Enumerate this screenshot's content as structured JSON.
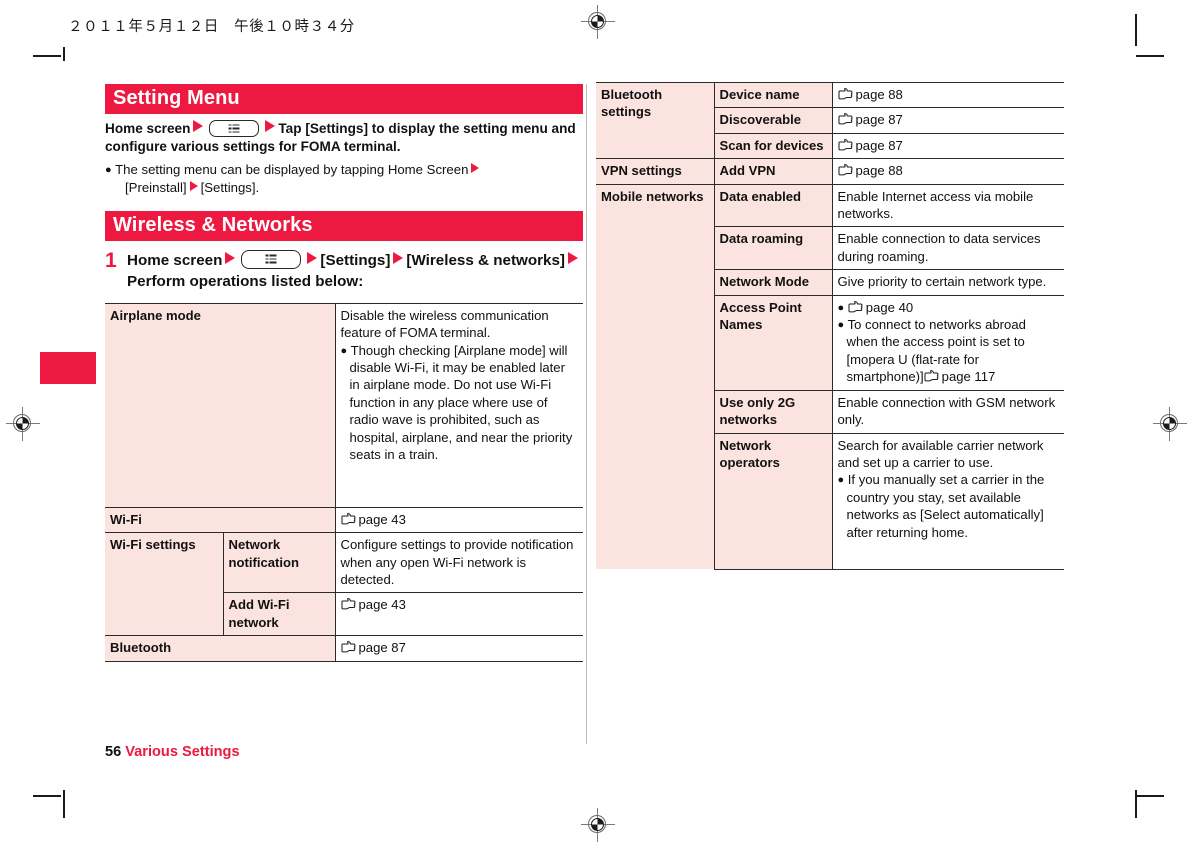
{
  "document": {
    "print_date_header": "２０１１年５月１２日　午後１０時３４分",
    "footer_page_number": "56",
    "footer_section": "Various Settings"
  },
  "colors": {
    "accent_red": "#ED1941",
    "table_header_fill": "#FBE4DF",
    "rule": "#2b2b2b"
  },
  "sections": {
    "setting_menu": {
      "banner": "Setting Menu",
      "lead_prefix": "Home screen",
      "lead_middle": "Tap [Settings] to display the setting menu and configure various settings for FOMA terminal.",
      "note_a": "The setting menu can be displayed by tapping Home Screen",
      "note_b": "[Preinstall]",
      "note_c": "[Settings]."
    },
    "wireless_networks": {
      "banner": "Wireless & Networks",
      "step_number": "1",
      "step_a": "Home screen",
      "step_b": "[Settings]",
      "step_c": "[Wireless & networks]",
      "step_d": "Perform operations listed below:"
    }
  },
  "icons": {
    "menu_key": "menu-key-icon",
    "arrow": "red-right-triangle-icon",
    "page_ref": "pointing-hand-icon"
  },
  "left_table": {
    "rows": [
      {
        "group": "Airplane mode",
        "group_rowspan": 1,
        "sub": null,
        "desc_lines": [
          "Disable the wireless communication feature of FOMA terminal."
        ],
        "desc_bullets": [
          "Though checking [Airplane mode] will disable Wi-Fi, it may be enabled later in airplane mode. Do not use Wi-Fi function in any place where use of radio wave is prohibited, such as hospital, airplane, and near the priority seats in a train."
        ],
        "page_ref": null
      },
      {
        "group": "Wi-Fi",
        "sub": null,
        "desc_lines": [],
        "desc_bullets": [],
        "page_ref": "page 43"
      },
      {
        "group": "Wi-Fi settings",
        "sub": "Network notification",
        "desc_lines": [
          "Configure settings to provide notification when any open Wi-Fi network is detected."
        ],
        "desc_bullets": [],
        "page_ref": null
      },
      {
        "group": null,
        "sub": "Add Wi-Fi network",
        "desc_lines": [],
        "desc_bullets": [],
        "page_ref": "page 43"
      },
      {
        "group": "Bluetooth",
        "sub": null,
        "desc_lines": [],
        "desc_bullets": [],
        "page_ref": "page 87"
      }
    ]
  },
  "right_table": {
    "rows": [
      {
        "group": "Bluetooth settings",
        "sub": "Device name",
        "desc_lines": [],
        "page_ref": "page 88"
      },
      {
        "group": null,
        "sub": "Discoverable",
        "desc_lines": [],
        "page_ref": "page 87"
      },
      {
        "group": null,
        "sub": "Scan for devices",
        "desc_lines": [],
        "page_ref": "page 87"
      },
      {
        "group": "VPN settings",
        "sub": "Add VPN",
        "desc_lines": [],
        "page_ref": "page 88"
      },
      {
        "group": "Mobile networks",
        "sub": "Data enabled",
        "desc_lines": [
          "Enable Internet access via mobile networks."
        ],
        "page_ref": null
      },
      {
        "group": null,
        "sub": "Data roaming",
        "desc_lines": [
          "Enable connection to data services during roaming."
        ],
        "page_ref": null
      },
      {
        "group": null,
        "sub": "Network Mode",
        "desc_lines": [
          "Give priority to certain network type."
        ],
        "page_ref": null
      },
      {
        "group": null,
        "sub": "Access Point Names",
        "desc_lines": [],
        "page_ref": null,
        "bullet_pageref": "page 40",
        "bullet_text_a": "To connect to networks abroad when the access point is set to [mopera U (flat-rate for smartphone)]",
        "bullet_text_a_ref": "page 117"
      },
      {
        "group": null,
        "sub": "Use only 2G networks",
        "desc_lines": [
          "Enable connection with GSM network only."
        ],
        "page_ref": null
      },
      {
        "group": null,
        "sub": "Network operators",
        "desc_lines": [
          "Search for available carrier network and set up a carrier to use."
        ],
        "bullet_text": "If you manually set a carrier in the country you stay, set available networks as [Select automatically] after returning home.",
        "page_ref": null
      }
    ]
  }
}
